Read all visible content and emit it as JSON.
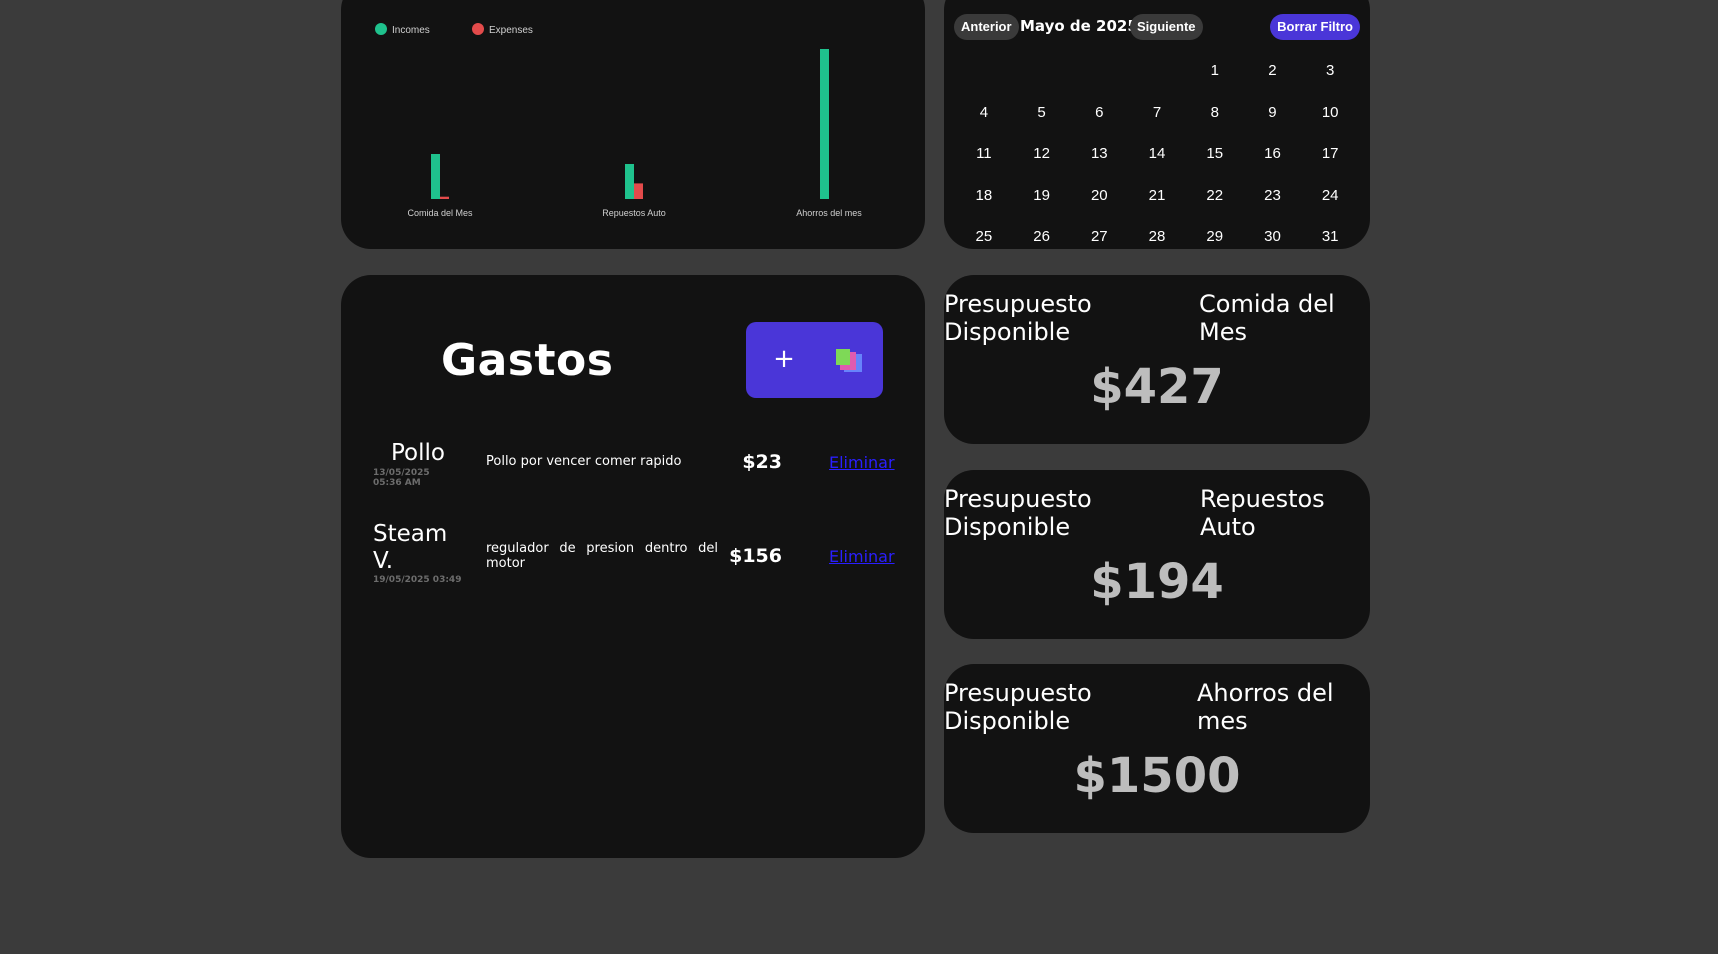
{
  "chart_data": {
    "type": "bar",
    "categories": [
      "Comida del Mes",
      "Repuestos Auto",
      "Ahorros del mes"
    ],
    "series": [
      {
        "name": "Incomes",
        "values": [
          450,
          350,
          1500
        ],
        "color": "#1fc28d"
      },
      {
        "name": "Expenses",
        "values": [
          23,
          156,
          0
        ],
        "color": "#e34b4b"
      }
    ],
    "legend_position": "top-left",
    "grid": false
  },
  "calendar": {
    "prev_label": "Anterior",
    "month_label": "Mayo de 2025",
    "next_label": "Siguiente",
    "clear_label": "Borrar Filtro",
    "weeks": [
      [
        "",
        "",
        "",
        "",
        "1",
        "2",
        "3"
      ],
      [
        "4",
        "5",
        "6",
        "7",
        "8",
        "9",
        "10"
      ],
      [
        "11",
        "12",
        "13",
        "14",
        "15",
        "16",
        "17"
      ],
      [
        "18",
        "19",
        "20",
        "21",
        "22",
        "23",
        "24"
      ],
      [
        "25",
        "26",
        "27",
        "28",
        "29",
        "30",
        "31"
      ]
    ]
  },
  "expenses": {
    "title": "Gastos",
    "add_label": "+",
    "items": [
      {
        "name": "Pollo",
        "date": "13/05/2025 05:36 AM",
        "description": "Pollo por vencer comer rapido",
        "amount": "$23",
        "delete_label": "Eliminar"
      },
      {
        "name": "Steam V.",
        "date": "19/05/2025 03:49",
        "description": "regulador de presion dentro del motor",
        "amount": "$156",
        "delete_label": "Eliminar"
      }
    ]
  },
  "budgets": [
    {
      "label": "Presupuesto Disponible",
      "category": "Comida del Mes",
      "amount": "$427"
    },
    {
      "label": "Presupuesto Disponible",
      "category": "Repuestos Auto",
      "amount": "$194"
    },
    {
      "label": "Presupuesto Disponible",
      "category": "Ahorros del mes",
      "amount": "$1500"
    }
  ]
}
